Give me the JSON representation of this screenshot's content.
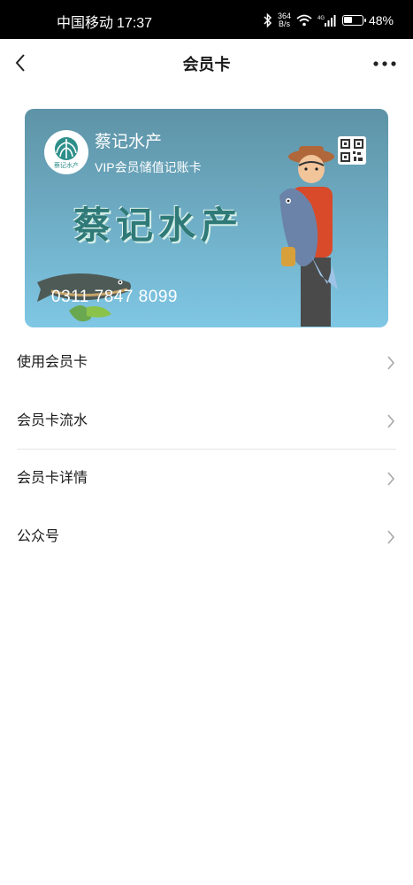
{
  "status_bar": {
    "carrier": "中国移动",
    "time": "17:37",
    "speed_value": "364",
    "speed_unit": "B/s",
    "network": "4G",
    "battery_percent": "48%",
    "battery_level": 0.48
  },
  "nav": {
    "title": "会员卡",
    "back_icon": "chevron-left-icon",
    "more_icon": "more-dots-icon"
  },
  "card": {
    "store_name": "蔡记水产",
    "card_type": "VIP会员储值记账卡",
    "art_text": "蔡记水产",
    "logo_text": "蔡记水产",
    "card_number": "0311 7847 8099",
    "gradient_top": "#5e93a6",
    "gradient_bottom": "#7fc7e4"
  },
  "menu": {
    "items": [
      {
        "label": "使用会员卡"
      },
      {
        "label": "会员卡流水"
      },
      {
        "label": "会员卡详情"
      },
      {
        "label": "公众号"
      }
    ]
  }
}
